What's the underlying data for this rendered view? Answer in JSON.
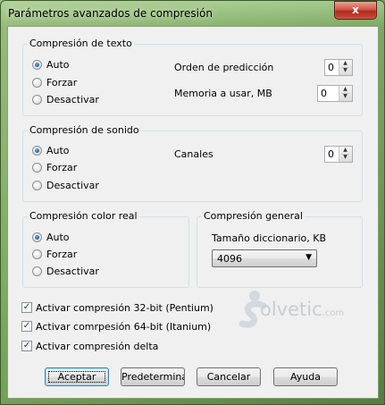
{
  "window": {
    "title": "Parámetros avanzados de compresión",
    "close_glyph": "x"
  },
  "text_compression": {
    "title": "Compresión de texto",
    "options": [
      "Auto",
      "Forzar",
      "Desactivar"
    ],
    "selected": "Auto",
    "prediction_order_label": "Orden de predicción",
    "prediction_order_value": "0",
    "memory_label": "Memoria a usar, MB",
    "memory_value": "0"
  },
  "sound_compression": {
    "title": "Compresión de sonido",
    "options": [
      "Auto",
      "Forzar",
      "Desactivar"
    ],
    "selected": "Auto",
    "channels_label": "Canales",
    "channels_value": "0"
  },
  "color_compression": {
    "title": "Compresión color real",
    "options": [
      "Auto",
      "Forzar",
      "Desactivar"
    ],
    "selected": "Auto"
  },
  "general_compression": {
    "title": "Compresión general",
    "dictionary_label": "Tamaño diccionario, KB",
    "dictionary_value": "4096"
  },
  "checkboxes": [
    {
      "label": "Activar compresión 32-bit (Pentium)",
      "checked": true
    },
    {
      "label": "Activar comrpesión 64-bit (Itanium)",
      "checked": true
    },
    {
      "label": "Activar compresión delta",
      "checked": true
    }
  ],
  "watermark": {
    "text": "olvetic",
    "suffix": ".com"
  },
  "buttons": {
    "accept": "Aceptar",
    "default": "Predeterminado",
    "cancel": "Cancelar",
    "help": "Ayuda"
  },
  "icons": {
    "close": "close-icon",
    "spin_up": "chevron-up-icon",
    "spin_down": "chevron-down-icon",
    "dropdown": "triangle-down-icon",
    "check": "checkmark-icon",
    "logo": "solvetic-logo"
  },
  "colors": {
    "frame_green": "#7fae62",
    "client_bg": "#f0f0f0",
    "close_red": "#c94a3a",
    "group_border": "#d5dfe5",
    "radio_fill": "#1d5ca5"
  }
}
